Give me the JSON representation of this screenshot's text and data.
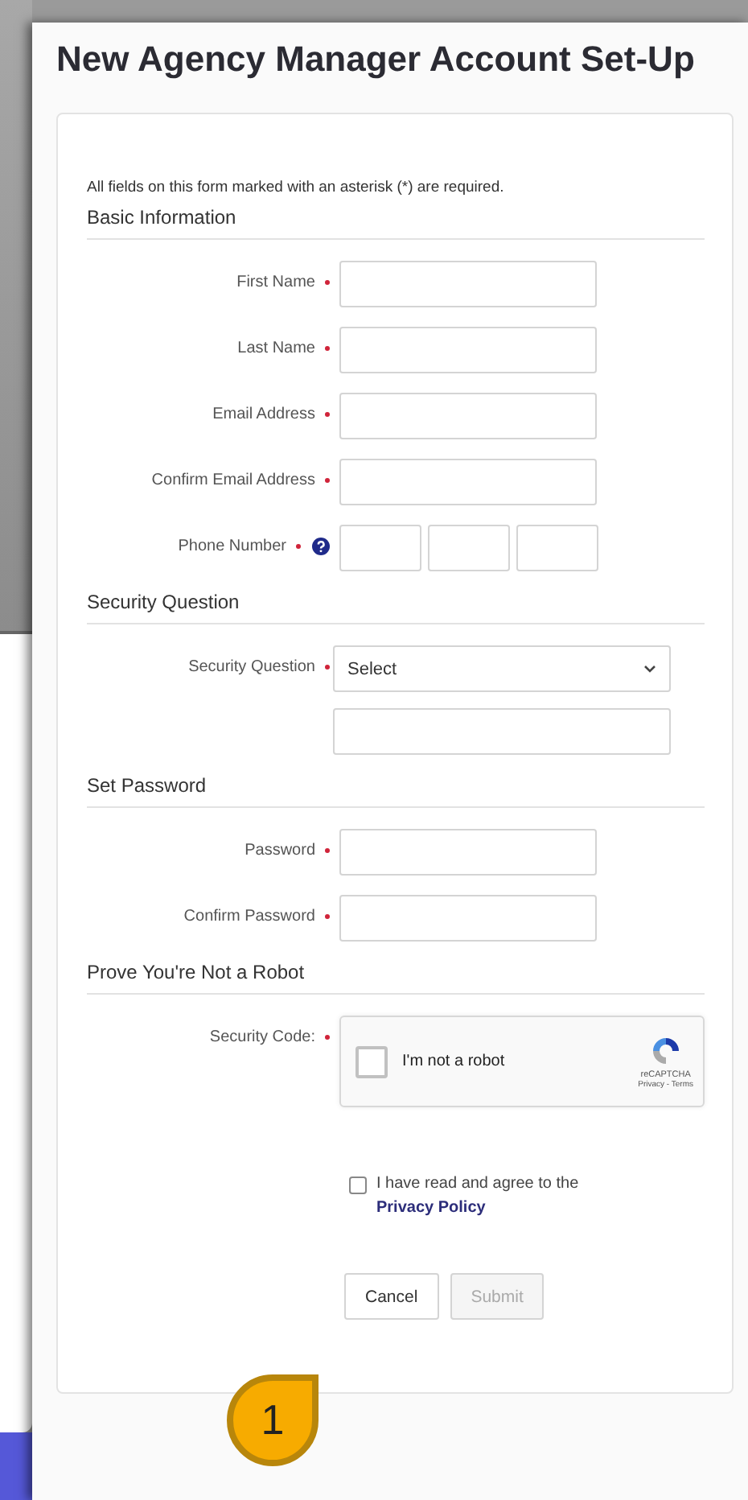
{
  "page": {
    "title": "New Agency Manager Account Set-Up"
  },
  "form": {
    "note": "All fields on this form marked with an asterisk (*) are required.",
    "sections": [
      {
        "heading": "Basic Information",
        "fields": [
          {
            "kind": "text",
            "label": "First Name",
            "required": true
          },
          {
            "kind": "text",
            "label": "Last Name",
            "required": true
          },
          {
            "kind": "text",
            "label": "Email Address",
            "required": true
          },
          {
            "kind": "text",
            "label": "Confirm Email Address",
            "required": true
          },
          {
            "kind": "phone",
            "label": "Phone Number",
            "required": true,
            "help": true
          }
        ]
      },
      {
        "heading": "Security Question",
        "fields": [
          {
            "kind": "select",
            "label": "Security Question",
            "required": true,
            "value": "Select"
          },
          {
            "kind": "wide"
          }
        ]
      },
      {
        "heading": "Set Password",
        "fields": [
          {
            "kind": "text",
            "label": "Password",
            "required": true
          },
          {
            "kind": "text",
            "label": "Confirm Password",
            "required": true
          }
        ]
      },
      {
        "heading": "Prove You're Not a Robot",
        "fields": [
          {
            "kind": "captcha",
            "label": "Security Code:",
            "required": true,
            "checked": false,
            "text": "I'm not a robot",
            "brand": "reCAPTCHA",
            "links": "Privacy - Terms"
          }
        ]
      }
    ],
    "agreement": {
      "checked": false,
      "text": "I have read and agree to the ",
      "link": "Privacy Policy"
    },
    "buttons": [
      {
        "label": "Cancel",
        "disabled": false
      },
      {
        "label": "Submit",
        "disabled": true
      }
    ]
  },
  "callout": {
    "text": "1"
  }
}
